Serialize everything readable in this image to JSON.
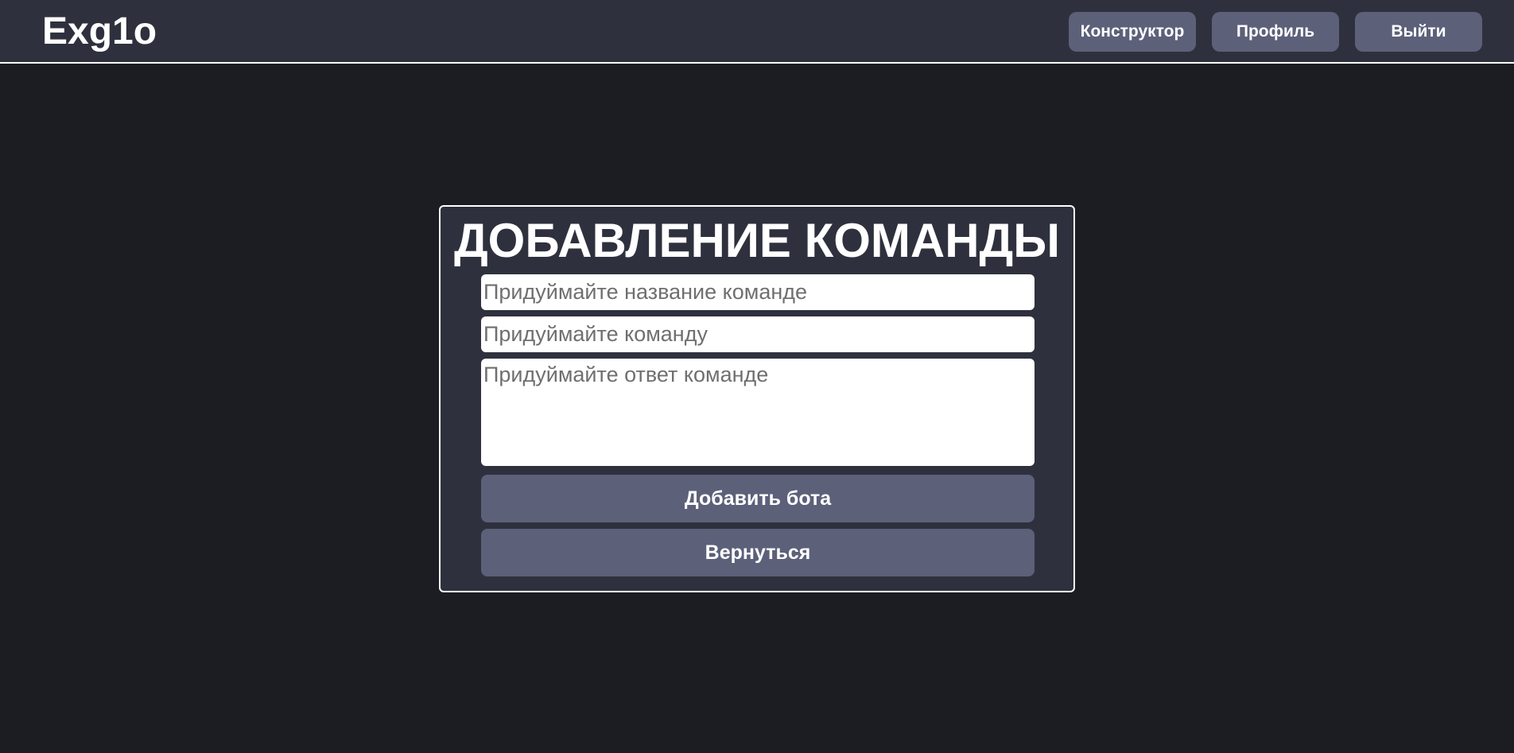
{
  "header": {
    "logo": "Exg1o",
    "nav": {
      "constructor_label": "Конструктор",
      "profile_label": "Профиль",
      "logout_label": "Выйти"
    }
  },
  "form": {
    "title": "ДОБАВЛЕНИЕ КОМАНДЫ",
    "name_placeholder": "Придуймайте название команде",
    "command_placeholder": "Придуймайте команду",
    "response_placeholder": "Придуймайте ответ команде",
    "add_button_label": "Добавить бота",
    "back_button_label": "Вернуться"
  },
  "colors": {
    "page_background": "#1c1d22",
    "panel_background": "#2e313d",
    "button_background": "#5c6079",
    "border": "#ffffff"
  }
}
